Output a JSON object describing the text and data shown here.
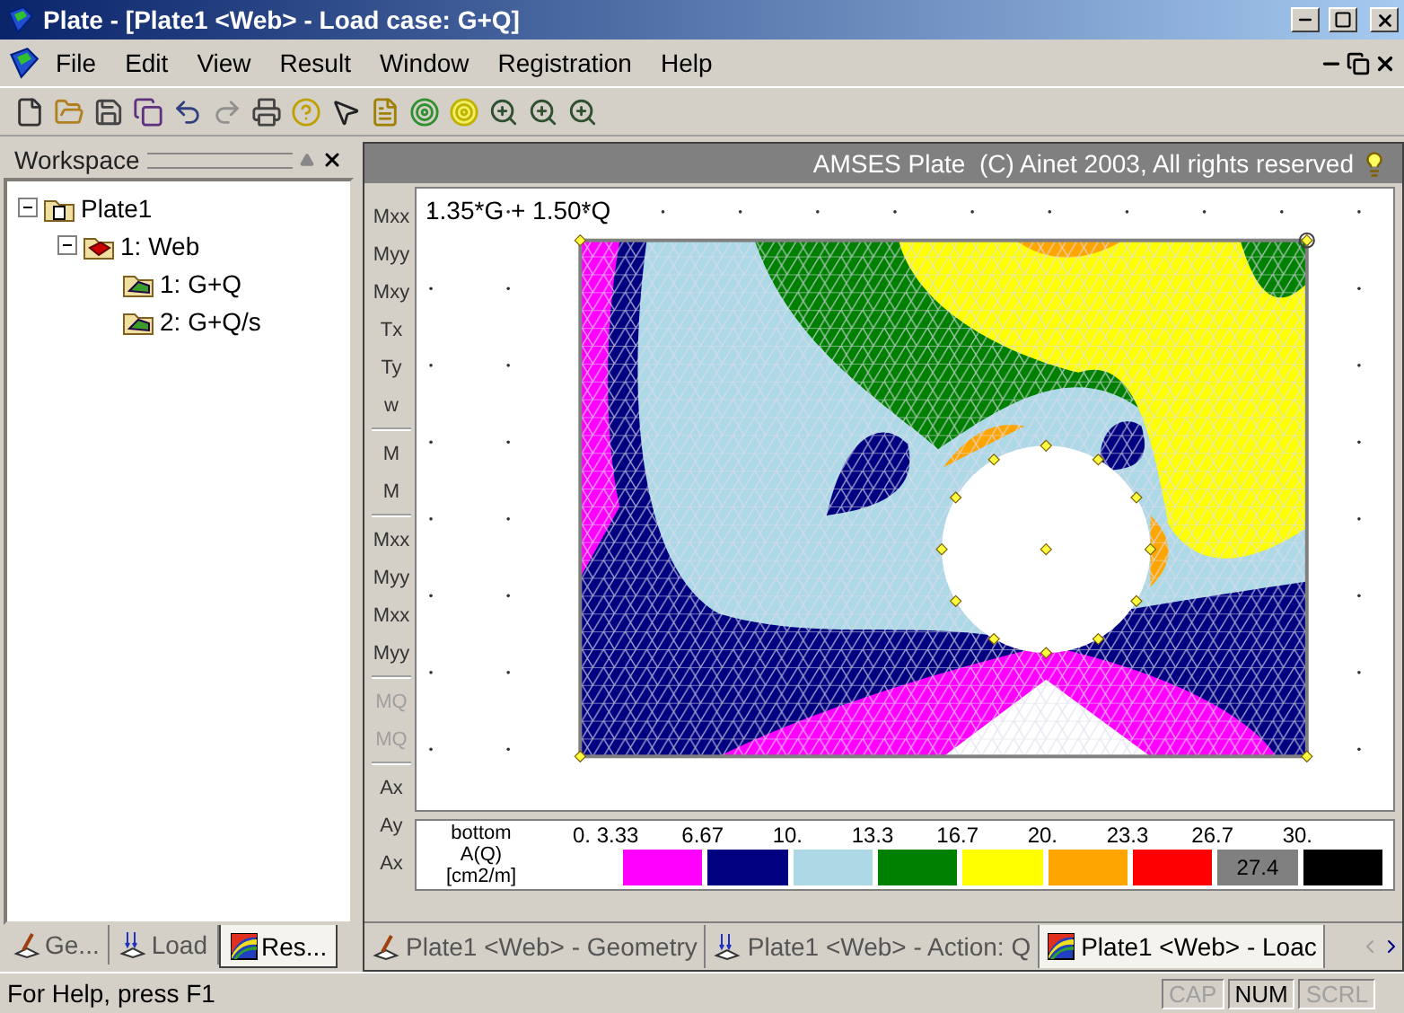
{
  "window": {
    "title": "Plate - [Plate1 <Web> - Load case: G+Q]"
  },
  "menu": [
    "File",
    "Edit",
    "View",
    "Result",
    "Window",
    "Registration",
    "Help"
  ],
  "workspace": {
    "title": "Workspace",
    "tree": [
      {
        "label": "Plate1",
        "kind": "project",
        "expanded": true,
        "children": [
          {
            "label": "1: Web",
            "kind": "plate",
            "expanded": true,
            "children": [
              {
                "label": "1: G+Q",
                "kind": "result"
              },
              {
                "label": "2: G+Q/s",
                "kind": "result"
              }
            ]
          }
        ]
      }
    ],
    "tabs": [
      {
        "label": "Ge...",
        "kind": "geometry",
        "selected": false
      },
      {
        "label": "Load",
        "kind": "load",
        "selected": false
      },
      {
        "label": "Res...",
        "kind": "result",
        "selected": true
      }
    ]
  },
  "banner": "AMSES Plate  (C) Ainet 2003, All rights reserved",
  "side_tools": [
    [
      {
        "label": "Mxx",
        "disabled": false
      },
      {
        "label": "Myy",
        "disabled": false
      },
      {
        "label": "Mxy",
        "disabled": false
      },
      {
        "label": "Tx",
        "disabled": false
      },
      {
        "label": "Ty",
        "disabled": false
      },
      {
        "label": "w",
        "disabled": false
      }
    ],
    [
      {
        "label": "M",
        "disabled": false
      },
      {
        "label": "M",
        "disabled": false
      }
    ],
    [
      {
        "label": "Mxx",
        "disabled": false
      },
      {
        "label": "Myy",
        "disabled": false
      },
      {
        "label": "Mxx",
        "disabled": false
      },
      {
        "label": "Myy",
        "disabled": false
      }
    ],
    [
      {
        "label": "MQ",
        "disabled": true
      },
      {
        "label": "MQ",
        "disabled": true
      }
    ],
    [
      {
        "label": "Ax",
        "disabled": false
      },
      {
        "label": "Ay",
        "disabled": false
      },
      {
        "label": "Ax",
        "disabled": false
      }
    ]
  ],
  "plot": {
    "caption": "1.35*G + 1.50*Q"
  },
  "legend": {
    "lines": [
      "bottom",
      "A(Q)",
      "[cm2/m]"
    ],
    "ticks": [
      "0.",
      "3.33",
      "6.67",
      "10.",
      "13.3",
      "16.7",
      "20.",
      "23.3",
      "26.7",
      "30."
    ],
    "bands": [
      {
        "color": "#ff00ff"
      },
      {
        "color": "#000080"
      },
      {
        "color": "#add8e6"
      },
      {
        "color": "#008000"
      },
      {
        "color": "#ffff00"
      },
      {
        "color": "#ffa500"
      },
      {
        "color": "#ff0000"
      },
      {
        "color": "#808080"
      },
      {
        "color": "#000000"
      }
    ],
    "max_label": "27.4"
  },
  "doc_tabs": [
    {
      "label": "Plate1 <Web> - Geometry",
      "kind": "geometry",
      "selected": false
    },
    {
      "label": "Plate1 <Web> - Action: Q",
      "kind": "load",
      "selected": false
    },
    {
      "label": "Plate1 <Web> - Loac",
      "kind": "result",
      "selected": true
    }
  ],
  "status_bar": {
    "text": "For Help, press F1",
    "indicators": [
      {
        "label": "CAP",
        "on": false
      },
      {
        "label": "NUM",
        "on": true
      },
      {
        "label": "SCRL",
        "on": false
      }
    ]
  }
}
